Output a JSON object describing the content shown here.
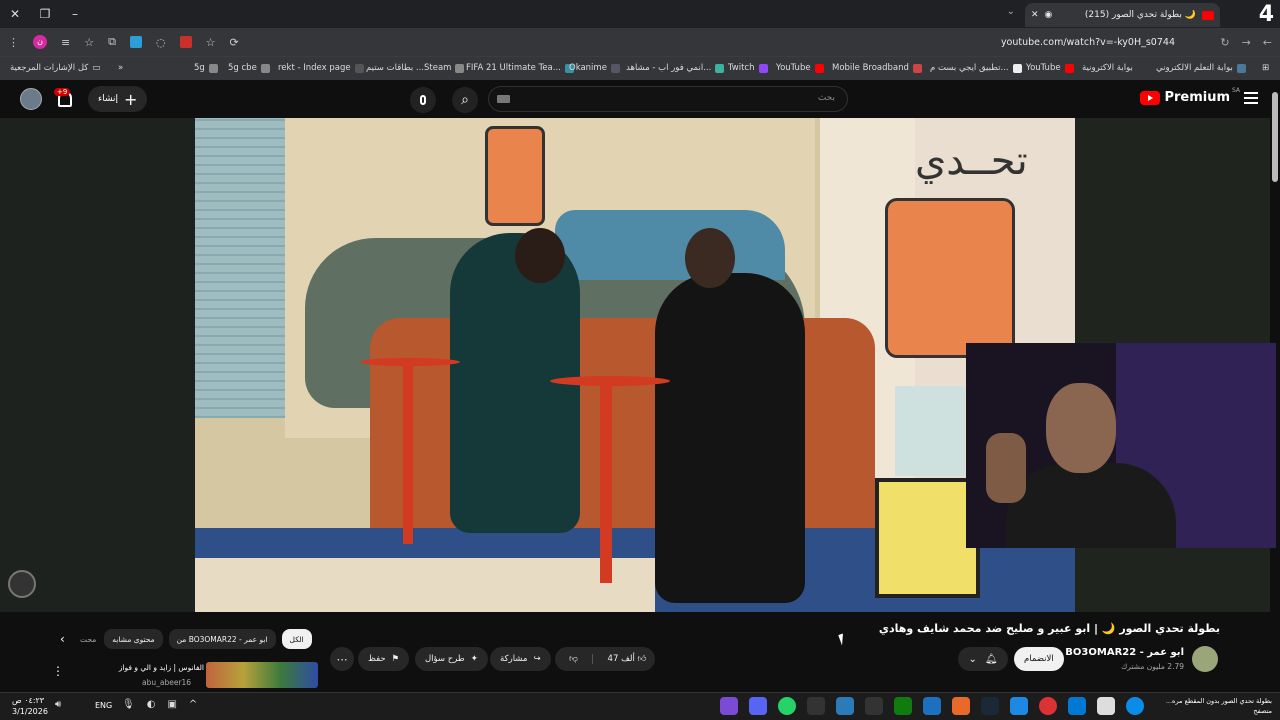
{
  "browser": {
    "tab_title": "(215) بطولة تحدي الصور 🌙",
    "tab_corner_number": "4",
    "url": "youtube.com/watch?v=-ky0H_s0744",
    "window_controls": [
      "close-icon",
      "restore-icon",
      "minimize-icon"
    ]
  },
  "bookmarks": [
    "بوابة التعلم الالكتروني",
    "بوابة الاكترونية",
    "YouTube",
    "تطبيق ايجي بست م...",
    "Mobile Broadband",
    "YouTube",
    "Twitch",
    "انمي فور اب - مشاهد...",
    "Okanime",
    "FIFA 21 Ultimate Tea...",
    "بطاقات ستيم ...Steam",
    "rekt - Index page",
    "5g cbe",
    "5g"
  ],
  "bookmarks_all": "كل الإشارات المرجعية",
  "yt_header": {
    "brand": "Premium",
    "region": "SA",
    "search_placeholder": "بحث",
    "create_label": "إنشاء",
    "notif_count": "+9"
  },
  "video": {
    "poster_text": "تحــدي"
  },
  "meta": {
    "title": "بطولة تحدي الصور 🌙 | ابو عبير و صليح ضد محمد شايف وهادي",
    "channel_name": "ابو عمر - BO3OMAR22",
    "subscribers": "2.79 مليون مشترك",
    "join_label": "الانضمام",
    "like_count": "47 ألف",
    "share_label": "مشاركة",
    "ask_label": "طرح سؤال",
    "save_label": "حفظ"
  },
  "chips": [
    "الكل",
    "من BO3OMAR22 - ابو عمر",
    "محتوى مشابه",
    "محت"
  ],
  "recommended": {
    "title": "الفانوس | زايد و الي و فواز",
    "channel": "abu_abeer16"
  },
  "taskbar": {
    "time": "٠٤:٢٣ ص",
    "date": "3/1/2026",
    "language": "ENG",
    "task_title": "بطولة تحدي الصور بدون المقطع مره...",
    "task_sub": "متصفح"
  }
}
